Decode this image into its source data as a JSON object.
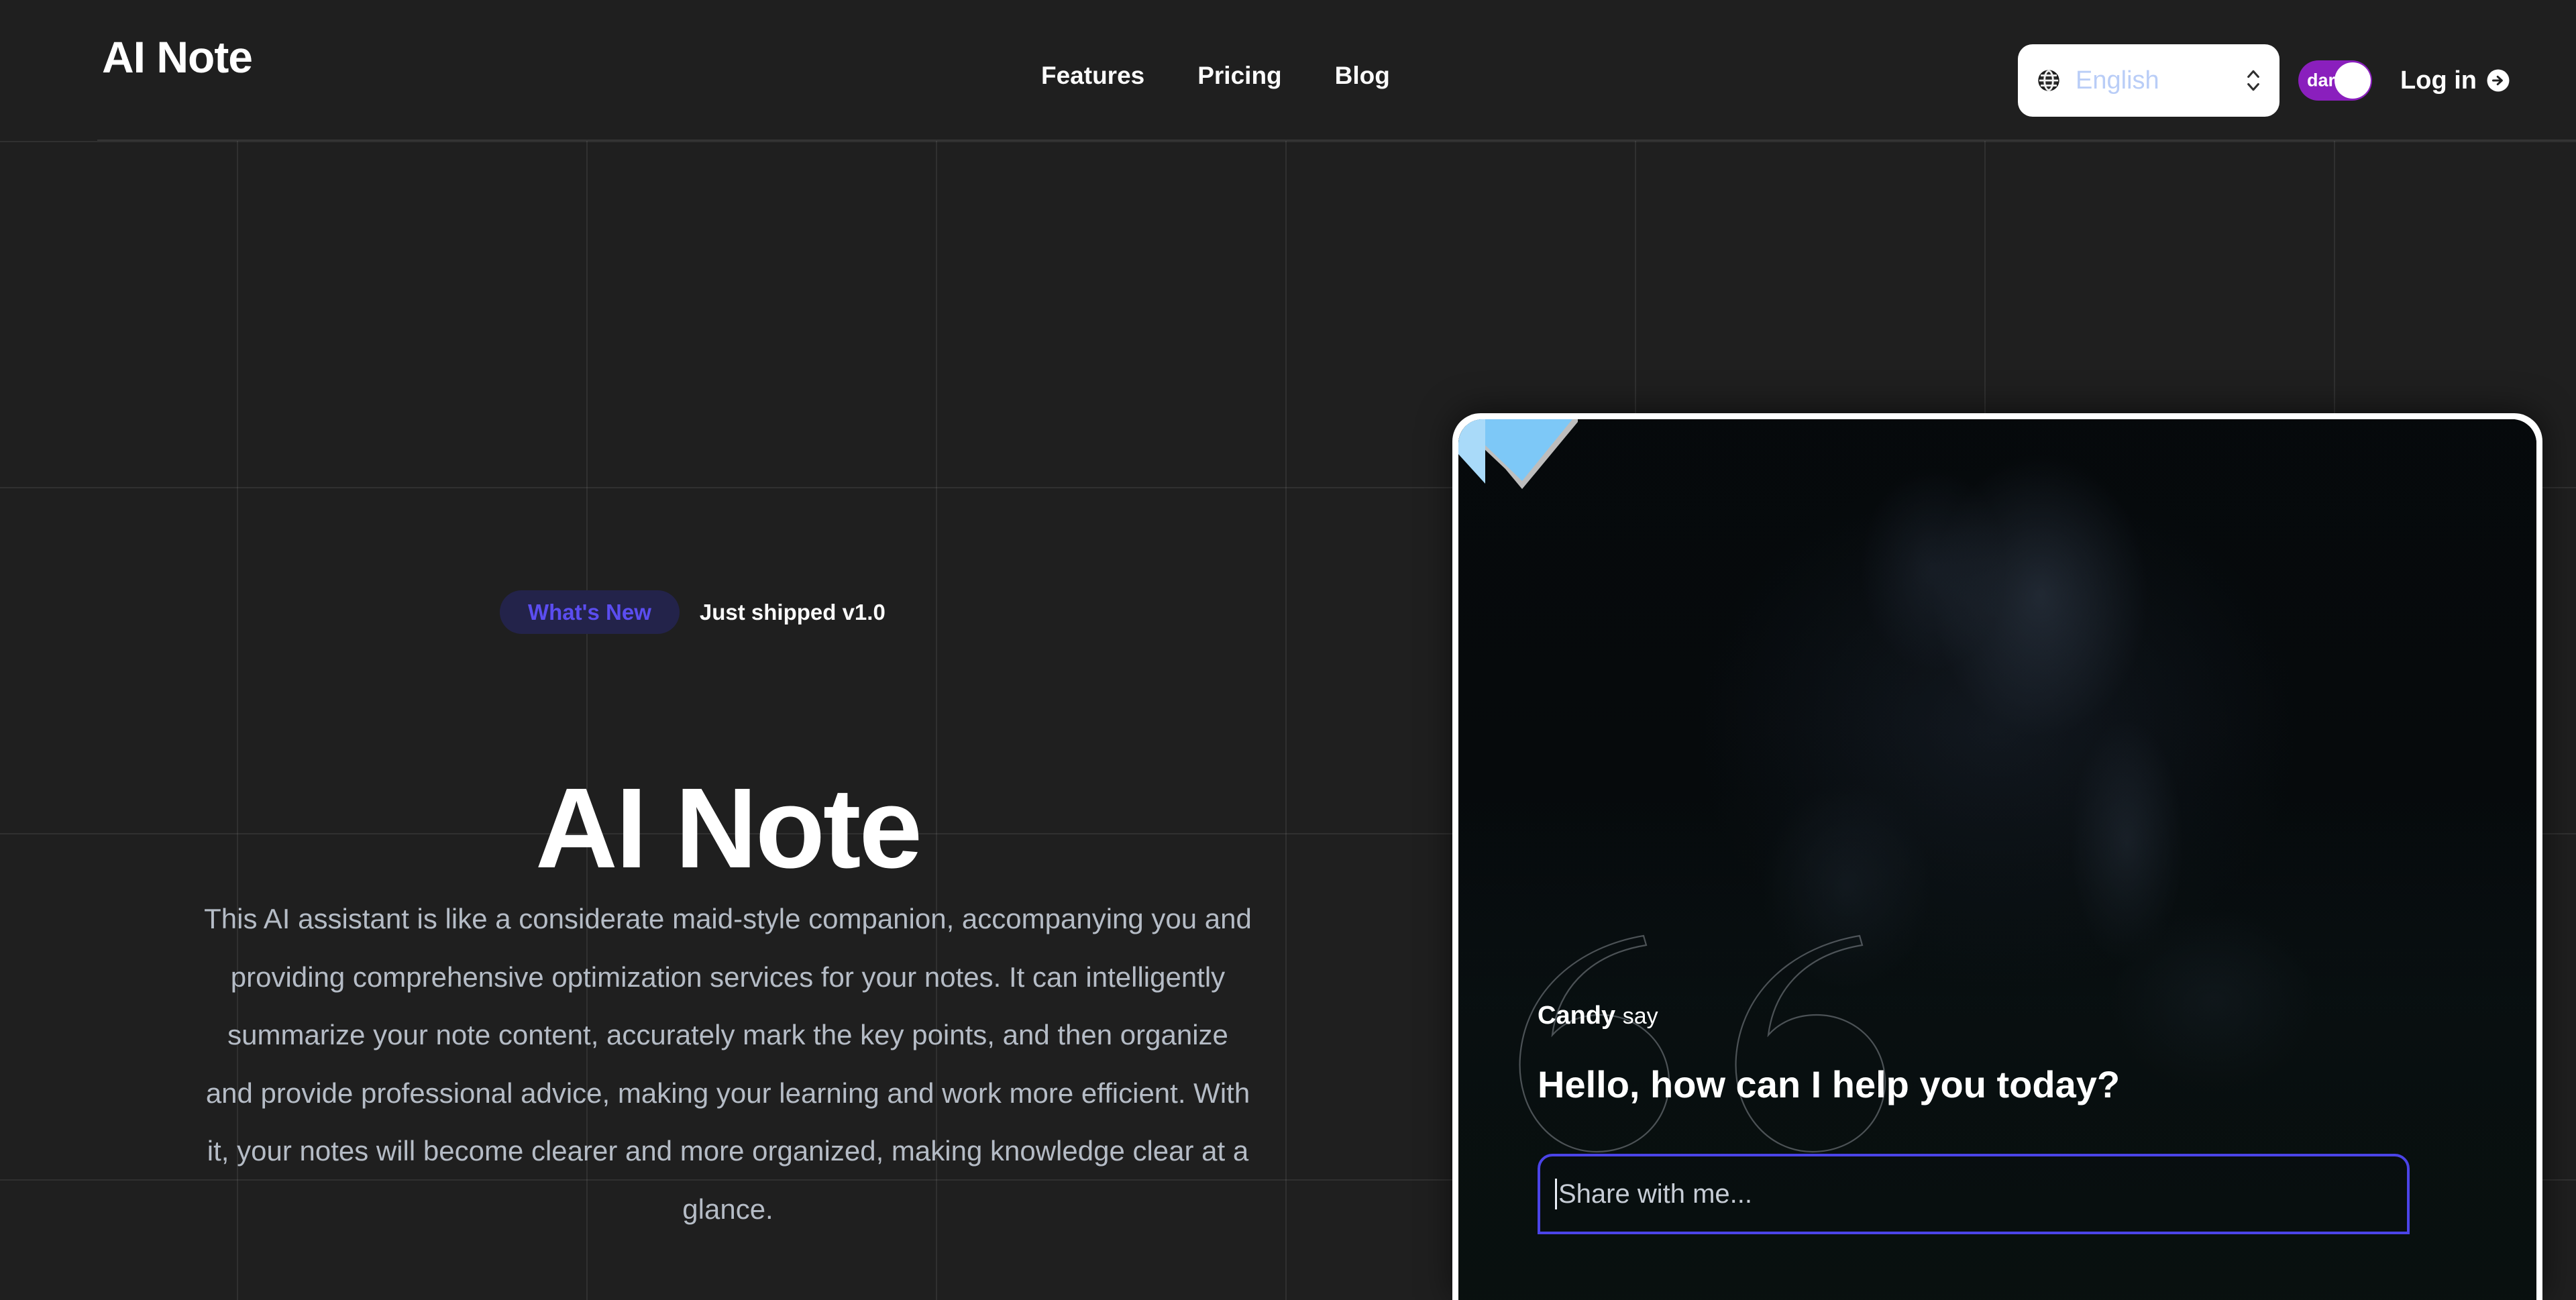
{
  "brand": {
    "name": "AI Note"
  },
  "nav": {
    "items": [
      {
        "label": "Features"
      },
      {
        "label": "Pricing"
      },
      {
        "label": "Blog"
      }
    ]
  },
  "header_controls": {
    "language": {
      "icon": "globe-icon",
      "value": "English",
      "chevron_icon": "chevron-up-down-icon"
    },
    "theme_toggle": {
      "label": "dark",
      "state": "on"
    },
    "login": {
      "label": "Log in",
      "icon": "arrow-right-circle-icon"
    }
  },
  "hero": {
    "badge": "What's New",
    "release_note": "Just shipped v1.0",
    "title": "AI Note",
    "paragraph": "This AI assistant is like a considerate maid-style companion, accompanying you and providing comprehensive optimization services for your notes. It can intelligently summarize your note content, accurately mark the key points, and then organize and provide professional advice, making your learning and work more efficient. With it, your notes will become clearer and more organized, making knowledge clear at a glance."
  },
  "chat_card": {
    "speaker_name": "Candy",
    "speaker_verb": "say",
    "message": "Hello, how can I help you today?",
    "input_placeholder": "Share with me...",
    "ribbon_icon": "bookmark-ribbon-icon",
    "quote_icon": "quotation-mark-icon"
  },
  "colors": {
    "page_background": "#1f1f1f",
    "accent_purple": "#8a1fbd",
    "badge_text": "#5b4df0",
    "badge_background": "#23234a",
    "input_border": "#4b44e8",
    "ribbon_blue": "#7dc8f7",
    "card_border": "#ffffff"
  }
}
